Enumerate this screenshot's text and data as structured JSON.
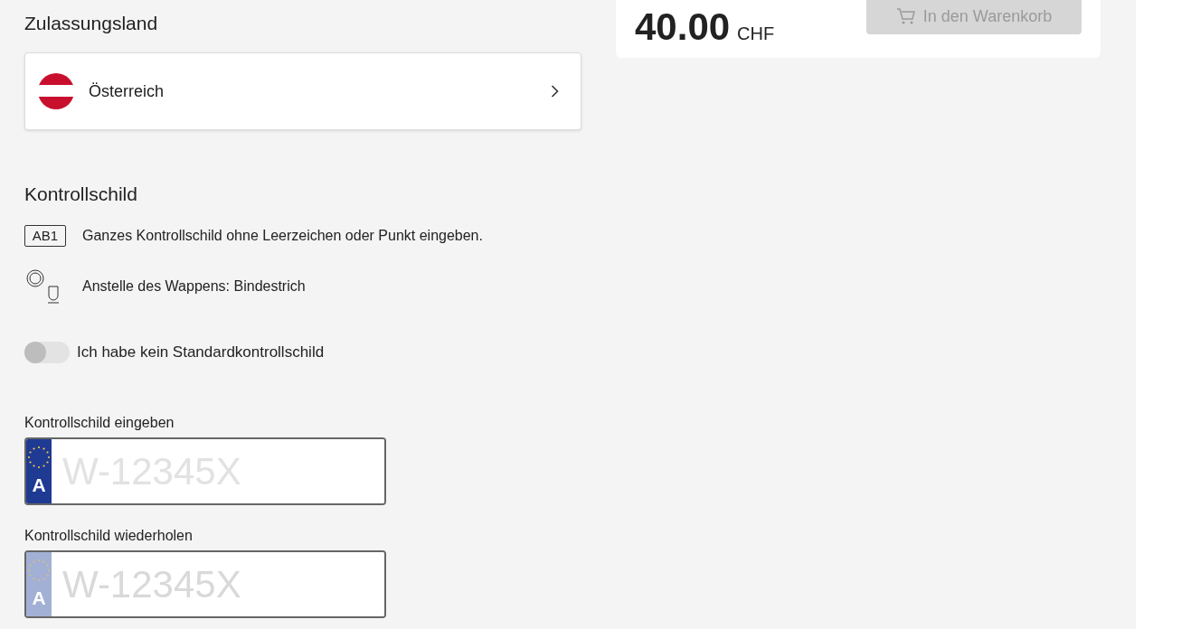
{
  "country_section": {
    "title": "Zulassungsland",
    "country": {
      "name": "Österreich"
    }
  },
  "plate_section": {
    "title": "Kontrollschild",
    "hints": [
      {
        "kind": "plate",
        "icon_text": "AB1",
        "text": "Ganzes Kontrollschild ohne Leerzeichen oder Punkt eingeben."
      },
      {
        "kind": "crest",
        "text": "Anstelle des Wappens: Bindestrich"
      }
    ],
    "toggle": {
      "label": "Ich habe kein Standardkontrollschild",
      "on": false
    },
    "fields": [
      {
        "label": "Kontrollschild eingeben",
        "country_code": "A",
        "placeholder": "W-12345X",
        "disabled": false
      },
      {
        "label": "Kontrollschild wiederholen",
        "country_code": "A",
        "placeholder": "W-12345X",
        "disabled": true
      }
    ]
  },
  "price_card": {
    "price": "40.00",
    "currency": "CHF",
    "cart_button": {
      "label": "In den Warenkorb",
      "disabled": true
    }
  }
}
